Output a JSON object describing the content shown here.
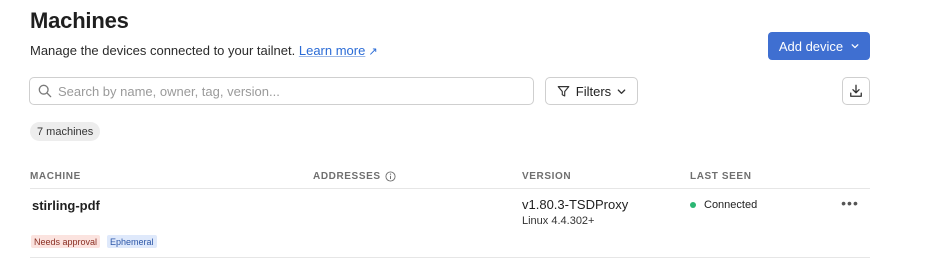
{
  "page": {
    "title": "Machines",
    "subtitle": "Manage the devices connected to your tailnet.",
    "learn_more": "Learn more"
  },
  "toolbar": {
    "add_device_label": "Add device",
    "search_placeholder": "Search by name, owner, tag, version...",
    "filters_label": "Filters",
    "count_badge": "7 machines"
  },
  "table": {
    "headers": {
      "machine": "MACHINE",
      "addresses": "ADDRESSES",
      "version": "VERSION",
      "last_seen": "LAST SEEN"
    },
    "rows": [
      {
        "name": "stirling-pdf",
        "tags": [
          "Needs approval",
          "Ephemeral"
        ],
        "version": "v1.80.3-TSDProxy",
        "os": "Linux 4.4.302+",
        "status": "Connected",
        "more": "•••"
      }
    ]
  },
  "colors": {
    "accent": "#3f6fd1",
    "link": "#2a6bd6",
    "connected": "#2bb673",
    "tag_approval_bg": "#fbe3df",
    "tag_ephemeral_bg": "#dfe9fb"
  },
  "icons": {
    "search": "search-icon",
    "filter": "filter-icon",
    "chevron": "chevron-down-icon",
    "export": "download-icon",
    "info": "info-icon",
    "external": "external-link-icon"
  }
}
